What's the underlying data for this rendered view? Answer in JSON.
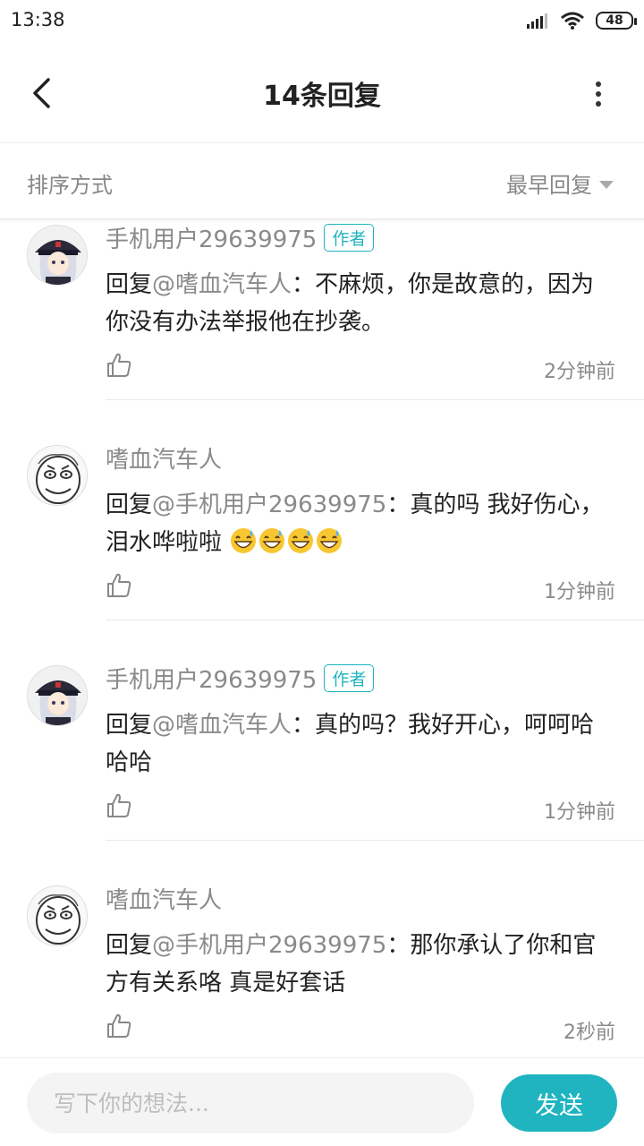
{
  "status_bar": {
    "time": "13:38",
    "battery": "48"
  },
  "header": {
    "title": "14条回复"
  },
  "sort": {
    "label": "排序方式",
    "selected": "最早回复"
  },
  "comments": [
    {
      "user": "手机用户29639975",
      "tag": "作者",
      "prefix": "回复",
      "mention": "@嗜血汽车人",
      "text": "：不麻烦，你是故意的，因为你没有办法举报他在抄袭。",
      "time": "2分钟前",
      "avatar": "anime-avatar"
    },
    {
      "user": "嗜血汽车人",
      "tag": "",
      "prefix": "回复",
      "mention": "@手机用户29639975",
      "text": "：真的吗 我好伤心，泪水哗啦啦",
      "emoji_count": 4,
      "time": "1分钟前",
      "avatar": "sketch-face-avatar"
    },
    {
      "user": "手机用户29639975",
      "tag": "作者",
      "prefix": "回复",
      "mention": "@嗜血汽车人",
      "text": "：真的吗？我好开心，呵呵哈哈哈",
      "time": "1分钟前",
      "avatar": "anime-avatar"
    },
    {
      "user": "嗜血汽车人",
      "tag": "",
      "prefix": "回复",
      "mention": "@手机用户29639975",
      "text": "：那你承认了你和官方有关系咯 真是好套话",
      "time": "2秒前",
      "avatar": "sketch-face-avatar"
    }
  ],
  "input": {
    "placeholder": "写下你的想法...",
    "send_label": "发送"
  },
  "colors": {
    "accent": "#1fb4c0",
    "muted": "#8a8a8a"
  }
}
